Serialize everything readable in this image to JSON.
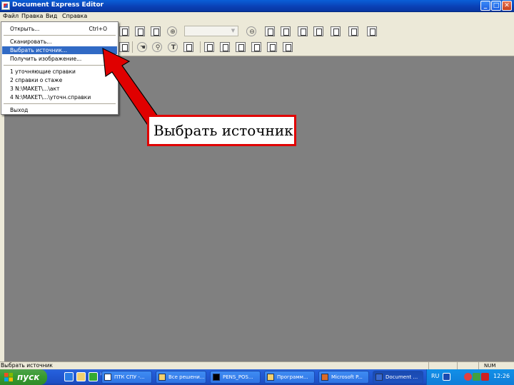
{
  "window": {
    "title": "Document Express Editor",
    "minimize_glyph": "_",
    "maximize_glyph": "□",
    "close_glyph": "✕"
  },
  "menubar": {
    "items": [
      "Файл",
      "Правка",
      "Вид",
      "Справка"
    ]
  },
  "toolbar": {
    "zoom_in_glyph": "⊕",
    "zoom_out_glyph": "⊖",
    "text_tool_glyph": "T",
    "combo_value": ""
  },
  "file_menu": {
    "items": [
      {
        "label": "Открыть...",
        "shortcut": "Ctrl+O"
      },
      {
        "label": "Сканировать..."
      },
      {
        "label": "Выбрать источник...",
        "selected": true
      },
      {
        "label": "Получить изображение..."
      },
      {
        "label": "1 уточняющие справки"
      },
      {
        "label": "2 справки о стаже"
      },
      {
        "label": "3 N:\\MAKET\\...\\акт"
      },
      {
        "label": "4 N:\\MAKET\\...\\уточн.справки"
      },
      {
        "label": "Выход"
      }
    ]
  },
  "callout": {
    "text": "Выбрать источник",
    "border_color": "#e00000",
    "arrow_color": "#e00000"
  },
  "statusbar": {
    "text": "Выбрать источник",
    "num_indicator": "NUM"
  },
  "taskbar": {
    "start_label": "пуск",
    "chevron": "»",
    "buttons": [
      {
        "label": "ПТК СПУ -...",
        "active": false
      },
      {
        "label": "Все решени...",
        "active": false
      },
      {
        "label": "PENS_POS...",
        "active": false
      },
      {
        "label": "Программ...",
        "active": false
      },
      {
        "label": "Microsoft P...",
        "active": false
      },
      {
        "label": "Document ...",
        "active": true
      }
    ],
    "tray": {
      "language": "RU",
      "time": "12:26"
    }
  },
  "colors": {
    "workspace": "#808080",
    "selection": "#316ac5",
    "titlebar": "#0a5fd8"
  }
}
